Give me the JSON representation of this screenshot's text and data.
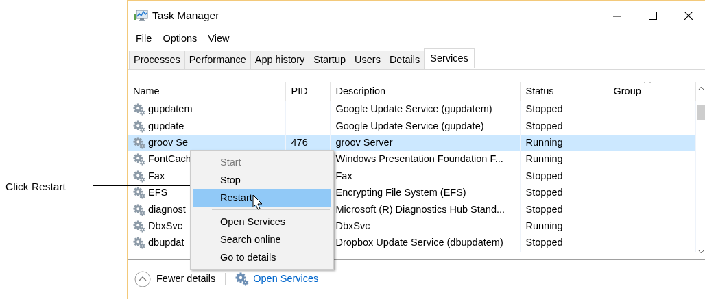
{
  "annotation": {
    "text": "Click Restart"
  },
  "window": {
    "title": "Task Manager"
  },
  "menu_bar": [
    "File",
    "Options",
    "View"
  ],
  "tabs": [
    {
      "label": "Processes",
      "selected": false
    },
    {
      "label": "Performance",
      "selected": false
    },
    {
      "label": "App history",
      "selected": false
    },
    {
      "label": "Startup",
      "selected": false
    },
    {
      "label": "Users",
      "selected": false
    },
    {
      "label": "Details",
      "selected": false
    },
    {
      "label": "Services",
      "selected": true
    }
  ],
  "table": {
    "columns": [
      {
        "label": "Name"
      },
      {
        "label": "PID"
      },
      {
        "label": "Description"
      },
      {
        "label": "Status"
      },
      {
        "label": "Group",
        "sorted": true
      }
    ],
    "rows": [
      {
        "name": "gupdatem",
        "pid": "",
        "description": "Google Update Service (gupdatem)",
        "status": "Stopped",
        "selected": false
      },
      {
        "name": "gupdate",
        "pid": "",
        "description": "Google Update Service (gupdate)",
        "status": "Stopped",
        "selected": false
      },
      {
        "name": "groov Se",
        "pid": "476",
        "description": "groov Server",
        "status": "Running",
        "selected": true
      },
      {
        "name": "FontCach",
        "pid": "",
        "description": "Windows Presentation Foundation F...",
        "status": "Running",
        "selected": false
      },
      {
        "name": "Fax",
        "pid": "",
        "description": "Fax",
        "status": "Stopped",
        "selected": false
      },
      {
        "name": "EFS",
        "pid": "",
        "description": "Encrypting File System (EFS)",
        "status": "Stopped",
        "selected": false
      },
      {
        "name": "diagnost",
        "pid": "",
        "description": "Microsoft (R) Diagnostics Hub Stand...",
        "status": "Stopped",
        "selected": false
      },
      {
        "name": "DbxSvc",
        "pid": "",
        "description": "DbxSvc",
        "status": "Running",
        "selected": false
      },
      {
        "name": "dbupdat",
        "pid": "",
        "description": "Dropbox Update Service (dbupdatem)",
        "status": "Stopped",
        "selected": false
      }
    ]
  },
  "context_menu": [
    {
      "kind": "item",
      "label": "Start",
      "disabled": true,
      "selected": false
    },
    {
      "kind": "item",
      "label": "Stop",
      "disabled": false,
      "selected": false
    },
    {
      "kind": "item",
      "label": "Restart",
      "disabled": false,
      "selected": true
    },
    {
      "kind": "separator"
    },
    {
      "kind": "item",
      "label": "Open Services",
      "disabled": false,
      "selected": false
    },
    {
      "kind": "item",
      "label": "Search online",
      "disabled": false,
      "selected": false
    },
    {
      "kind": "item",
      "label": "Go to details",
      "disabled": false,
      "selected": false
    }
  ],
  "footer": {
    "fewer_details": "Fewer details",
    "open_services": "Open Services"
  }
}
